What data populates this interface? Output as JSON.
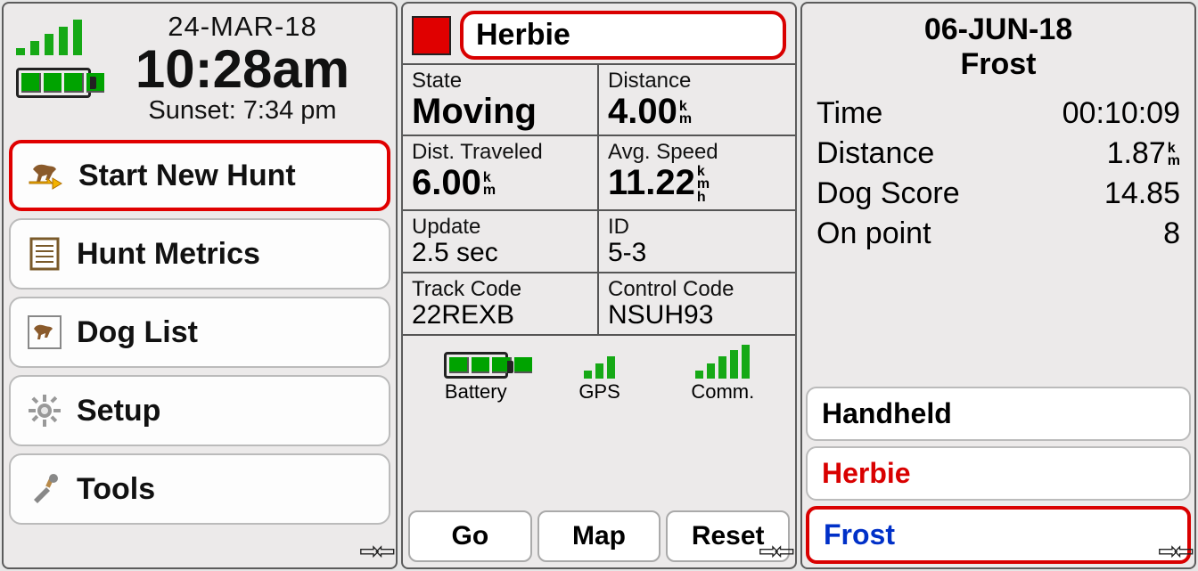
{
  "screen1": {
    "date": "24-MAR-18",
    "time": "10:28am",
    "sunset": "Sunset: 7:34 pm",
    "menu": [
      {
        "label": "Start New Hunt",
        "icon": "dog-arrow-icon",
        "selected": true
      },
      {
        "label": "Hunt Metrics",
        "icon": "list-icon"
      },
      {
        "label": "Dog List",
        "icon": "dog-icon"
      },
      {
        "label": "Setup",
        "icon": "gear-icon"
      },
      {
        "label": "Tools",
        "icon": "tools-icon"
      }
    ]
  },
  "screen2": {
    "dog_name": "Herbie",
    "color": "#e00000",
    "fields": {
      "state": {
        "label": "State",
        "value": "Moving"
      },
      "distance": {
        "label": "Distance",
        "value": "4.00",
        "unit": "k m"
      },
      "dist_trav": {
        "label": "Dist. Traveled",
        "value": "6.00",
        "unit": "k m"
      },
      "avg_speed": {
        "label": "Avg. Speed",
        "value": "11.22",
        "unit": "k m h"
      },
      "update": {
        "label": "Update",
        "value": "2.5 sec"
      },
      "id": {
        "label": "ID",
        "value": "5-3"
      },
      "track_code": {
        "label": "Track Code",
        "value": "22REXB"
      },
      "control_code": {
        "label": "Control Code",
        "value": "NSUH93"
      }
    },
    "status": {
      "battery": "Battery",
      "gps": "GPS",
      "comm": "Comm."
    },
    "buttons": {
      "go": "Go",
      "map": "Map",
      "reset": "Reset"
    }
  },
  "screen3": {
    "date": "06-JUN-18",
    "name": "Frost",
    "stats": {
      "time": {
        "label": "Time",
        "value": "00:10:09"
      },
      "distance": {
        "label": "Distance",
        "value": "1.87",
        "unit": "k m"
      },
      "dog_score": {
        "label": "Dog Score",
        "value": "14.85"
      },
      "on_point": {
        "label": "On point",
        "value": "8"
      }
    },
    "list": [
      {
        "label": "Handheld",
        "style": "plain"
      },
      {
        "label": "Herbie",
        "style": "red"
      },
      {
        "label": "Frost",
        "style": "blue"
      }
    ]
  }
}
